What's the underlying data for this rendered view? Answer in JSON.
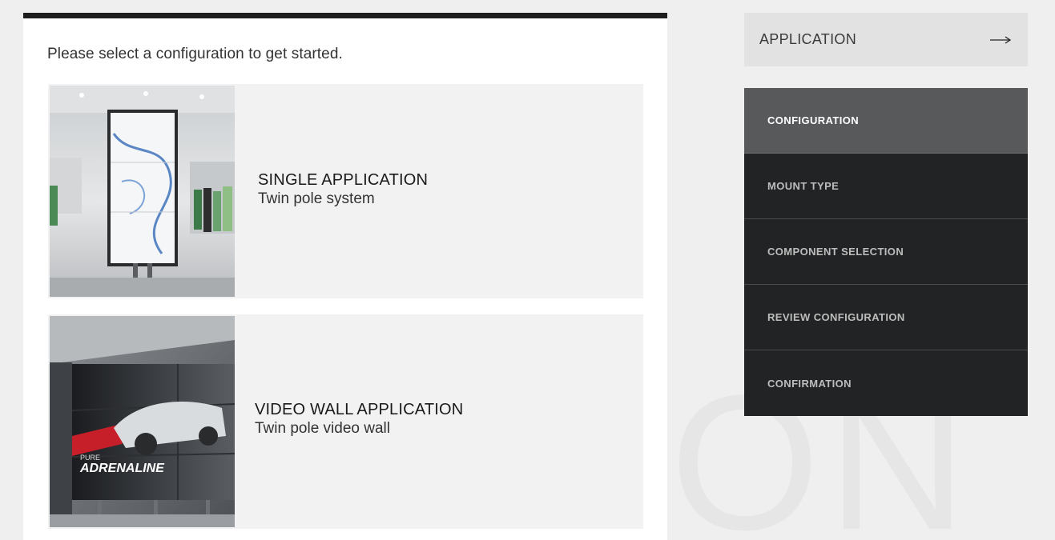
{
  "watermark": {
    "text": "ION"
  },
  "main": {
    "intro": "Please select a configuration to get started.",
    "cards": [
      {
        "title": "SINGLE APPLICATION",
        "subtitle": "Twin pole system",
        "image": "retail-store-display-photo"
      },
      {
        "title": "VIDEO WALL APPLICATION",
        "subtitle": "Twin pole video wall",
        "image": "video-wall-car-ad-photo",
        "image_text_small": "PURE",
        "image_text_large": "ADRENALINE"
      }
    ]
  },
  "sidebar": {
    "application_label": "APPLICATION",
    "arrow_icon": "arrow-right-icon",
    "steps": [
      {
        "label": "CONFIGURATION",
        "active": true
      },
      {
        "label": "MOUNT TYPE",
        "active": false
      },
      {
        "label": "COMPONENT SELECTION",
        "active": false
      },
      {
        "label": "REVIEW CONFIGURATION",
        "active": false
      },
      {
        "label": "CONFIRMATION",
        "active": false
      }
    ]
  },
  "colors": {
    "background": "#efefef",
    "panel": "#ffffff",
    "card": "#f2f2f2",
    "step_active": "#58595b",
    "step_inactive": "#222324",
    "top_bar": "#1e1e1e"
  }
}
